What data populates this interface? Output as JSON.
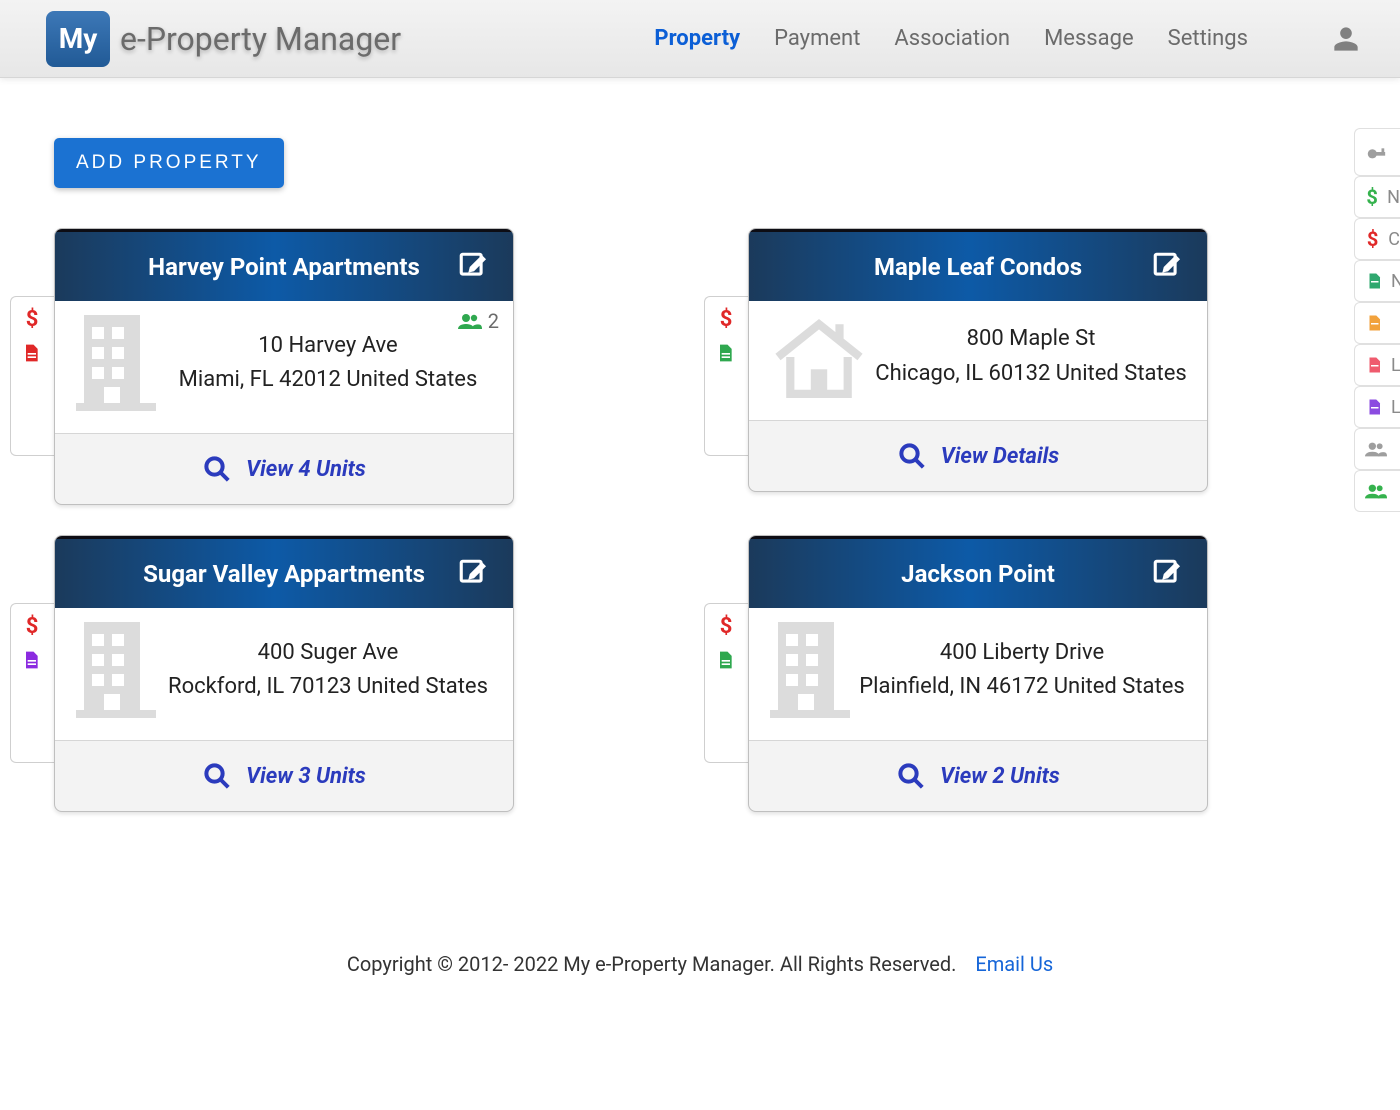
{
  "brand": {
    "logo_text": "My",
    "title": "e-Property Manager"
  },
  "nav": {
    "items": [
      {
        "label": "Property",
        "active": true
      },
      {
        "label": "Payment",
        "active": false
      },
      {
        "label": "Association",
        "active": false
      },
      {
        "label": "Message",
        "active": false
      },
      {
        "label": "Settings",
        "active": false
      }
    ]
  },
  "actions": {
    "add_property": "ADD PROPERTY"
  },
  "properties": [
    {
      "name": "Harvey Point Apartments",
      "address_line1": "10 Harvey Ave",
      "address_line2": "Miami, FL 42012 United States",
      "icon": "building",
      "occupants": "2",
      "footer_label": "View 4 Units",
      "side_icons": [
        "dollar-red",
        "file-red"
      ]
    },
    {
      "name": "Maple Leaf Condos",
      "address_line1": "800 Maple St",
      "address_line2": "Chicago, IL 60132 United States",
      "icon": "house",
      "occupants": null,
      "footer_label": "View Details",
      "side_icons": [
        "dollar-red",
        "file-green"
      ]
    },
    {
      "name": "Sugar Valley Appartments",
      "address_line1": "400 Suger Ave",
      "address_line2": "Rockford, IL 70123 United States",
      "icon": "building",
      "occupants": null,
      "footer_label": "View 3 Units",
      "side_icons": [
        "dollar-red",
        "file-purple"
      ]
    },
    {
      "name": "Jackson Point",
      "address_line1": "400 Liberty Drive",
      "address_line2": "Plainfield, IN 46172 United States",
      "icon": "building",
      "occupants": null,
      "footer_label": "View 2 Units",
      "side_icons": [
        "dollar-red",
        "file-green"
      ]
    }
  ],
  "rail": [
    {
      "icon": "key",
      "color": "c-gray",
      "label": ""
    },
    {
      "icon": "dollar",
      "color": "c-green",
      "label": "N"
    },
    {
      "icon": "dollar",
      "color": "c-red",
      "label": "C"
    },
    {
      "icon": "file",
      "color": "c-teal",
      "label": "N"
    },
    {
      "icon": "file",
      "color": "c-amber",
      "label": ""
    },
    {
      "icon": "file",
      "color": "c-rose",
      "label": "L"
    },
    {
      "icon": "file",
      "color": "c-purple",
      "label": "L"
    },
    {
      "icon": "group",
      "color": "c-gray",
      "label": ""
    },
    {
      "icon": "group",
      "color": "c-green",
      "label": ""
    }
  ],
  "footer": {
    "copyright": "Copyright © 2012- 2022 My e-Property Manager. All Rights Reserved.",
    "email_label": "Email Us"
  }
}
